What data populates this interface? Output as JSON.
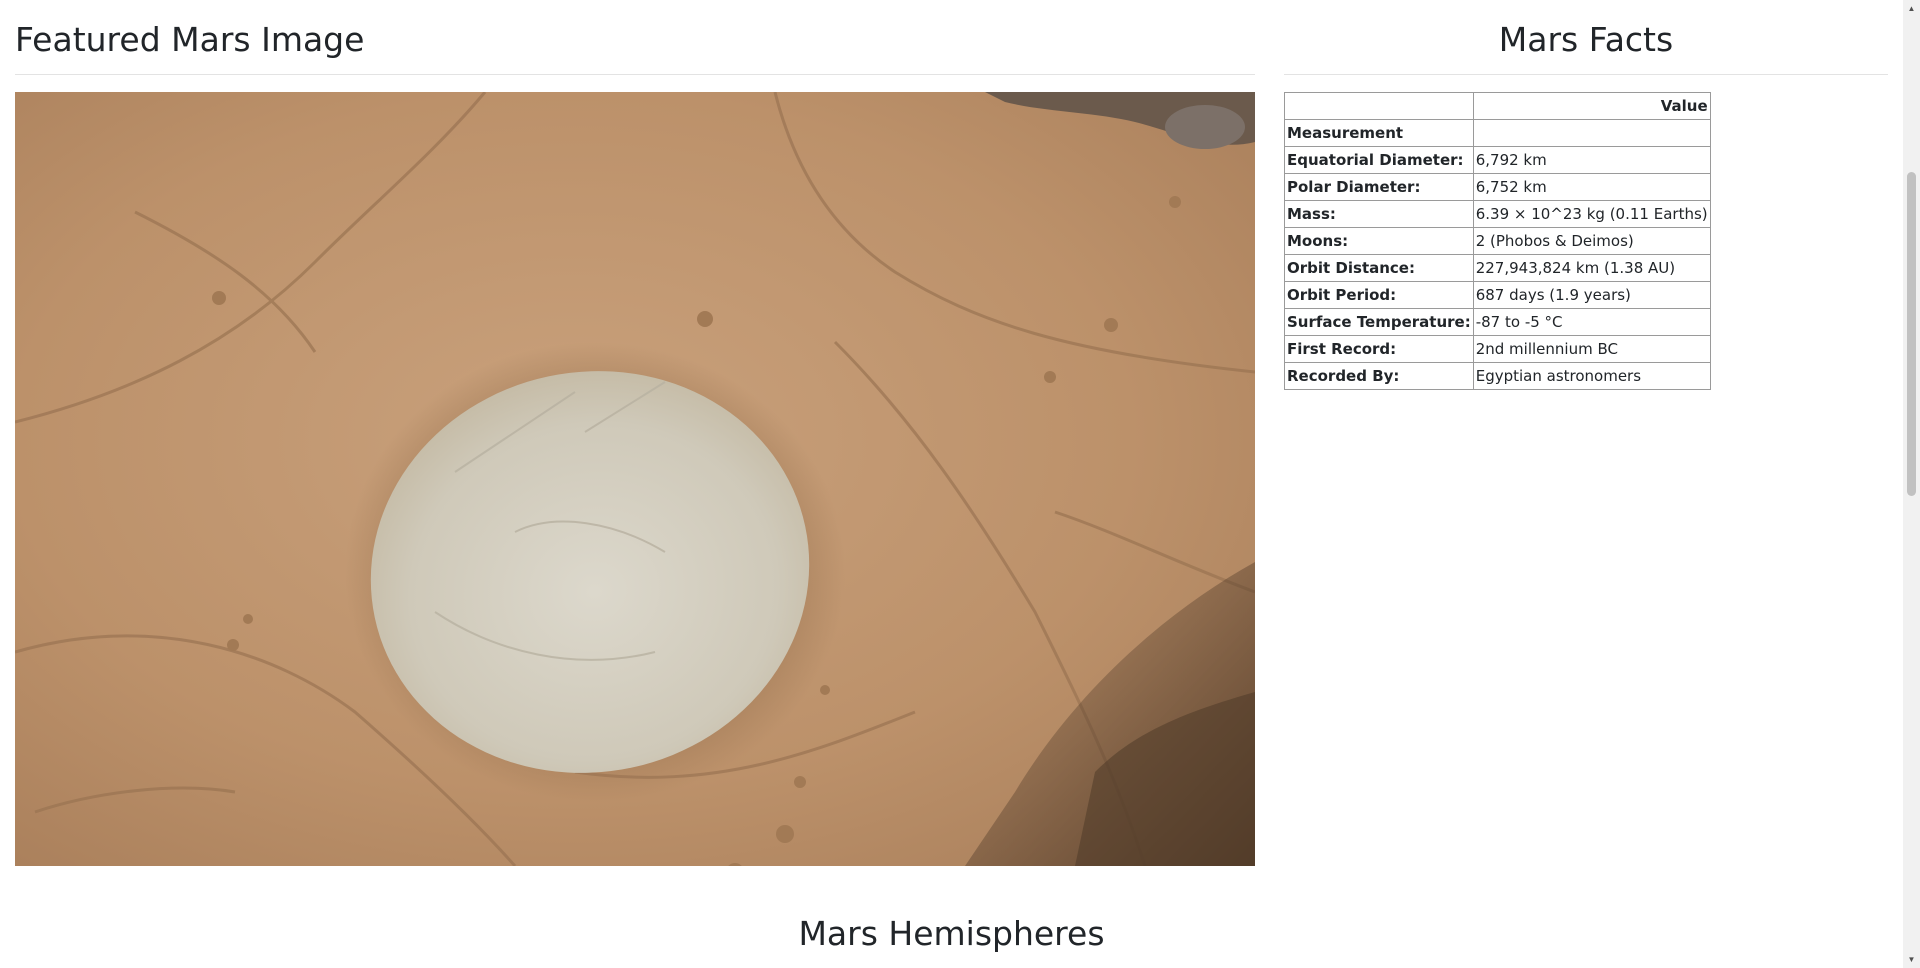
{
  "featured": {
    "title": "Featured Mars Image",
    "image_alt": "Mars surface close-up showing a brushed rock patch"
  },
  "facts": {
    "title": "Mars Facts",
    "header_value": "Value",
    "header_measurement": "Measurement",
    "rows": [
      {
        "label": "Equatorial Diameter:",
        "value": "6,792 km"
      },
      {
        "label": "Polar Diameter:",
        "value": "6,752 km"
      },
      {
        "label": "Mass:",
        "value": "6.39 × 10^23 kg (0.11 Earths)"
      },
      {
        "label": "Moons:",
        "value": "2 (Phobos & Deimos)"
      },
      {
        "label": "Orbit Distance:",
        "value": "227,943,824 km (1.38 AU)"
      },
      {
        "label": "Orbit Period:",
        "value": "687 days (1.9 years)"
      },
      {
        "label": "Surface Temperature:",
        "value": "-87 to -5 °C"
      },
      {
        "label": "First Record:",
        "value": "2nd millennium BC"
      },
      {
        "label": "Recorded By:",
        "value": "Egyptian astronomers"
      }
    ]
  },
  "hemispheres": {
    "title": "Mars Hemispheres"
  },
  "scrollbar": {
    "up_icon": "triangle-up-icon",
    "down_icon": "triangle-down-icon"
  }
}
